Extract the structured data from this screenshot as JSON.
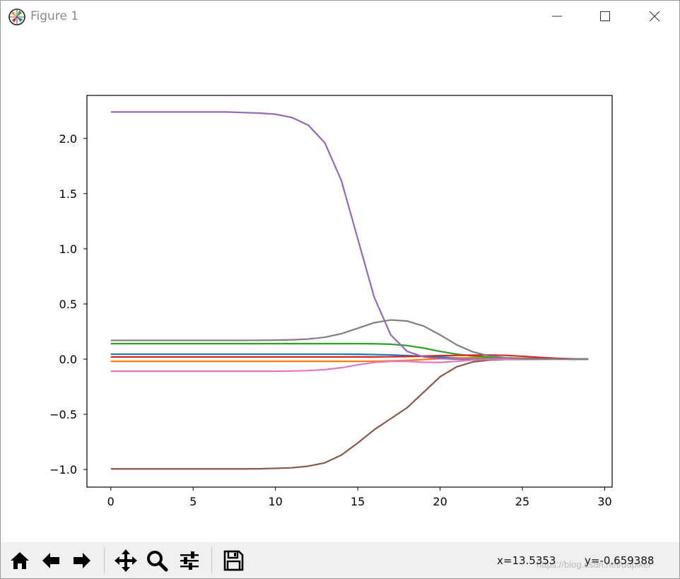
{
  "window": {
    "title": "Figure 1",
    "icon": "matplotlib-logo-icon",
    "controls": [
      "minimize-icon",
      "maximize-icon",
      "close-icon"
    ]
  },
  "toolbar": {
    "buttons": [
      {
        "name": "home-button",
        "icon": "home-icon"
      },
      {
        "name": "back-button",
        "icon": "arrow-left-icon"
      },
      {
        "name": "forward-button",
        "icon": "arrow-right-icon"
      },
      {
        "name": "pan-button",
        "icon": "move-icon"
      },
      {
        "name": "zoom-button",
        "icon": "magnifier-icon"
      },
      {
        "name": "configure-subplots-button",
        "icon": "sliders-icon"
      },
      {
        "name": "save-button",
        "icon": "floppy-disk-icon"
      }
    ],
    "cursor_x": "x=13.5353",
    "cursor_y": "y=-0.659388",
    "watermark": "https://blog.csdn.net/dupiker"
  },
  "chart_data": {
    "type": "line",
    "title": "",
    "xlabel": "",
    "ylabel": "",
    "xlim": [
      -1.45,
      30.45
    ],
    "ylim": [
      -1.16,
      2.39
    ],
    "grid": false,
    "xticks": [
      0,
      5,
      10,
      15,
      20,
      25,
      30
    ],
    "yticks": [
      2.0,
      1.5,
      1.0,
      0.5,
      0.0,
      -0.5,
      -1.0
    ],
    "ytick_labels": [
      "2.0",
      "1.5",
      "1.0",
      "0.5",
      "0.0",
      "−0.5",
      "−1.0"
    ],
    "x": [
      0,
      1,
      2,
      3,
      4,
      5,
      6,
      7,
      8,
      9,
      10,
      11,
      12,
      13,
      14,
      15,
      16,
      17,
      18,
      19,
      20,
      21,
      22,
      23,
      24,
      25,
      26,
      27,
      28,
      29
    ],
    "series": [
      {
        "color": "#1f77b4",
        "values": [
          0.045,
          0.045,
          0.045,
          0.045,
          0.045,
          0.045,
          0.045,
          0.045,
          0.045,
          0.045,
          0.045,
          0.045,
          0.045,
          0.045,
          0.045,
          0.044,
          0.042,
          0.038,
          0.032,
          0.025,
          0.018,
          0.012,
          0.008,
          0.005,
          0.003,
          0.002,
          0.001,
          0.001,
          0.0,
          0.0
        ]
      },
      {
        "color": "#ff7f0e",
        "values": [
          -0.02,
          -0.02,
          -0.02,
          -0.02,
          -0.02,
          -0.02,
          -0.02,
          -0.02,
          -0.02,
          -0.02,
          -0.02,
          -0.02,
          -0.02,
          -0.02,
          -0.02,
          -0.02,
          -0.019,
          -0.016,
          -0.011,
          -0.004,
          0.004,
          0.01,
          0.013,
          0.014,
          0.012,
          0.009,
          0.006,
          0.003,
          0.001,
          0.0
        ]
      },
      {
        "color": "#2ca02c",
        "values": [
          0.14,
          0.14,
          0.14,
          0.14,
          0.14,
          0.14,
          0.14,
          0.14,
          0.14,
          0.14,
          0.14,
          0.14,
          0.14,
          0.14,
          0.14,
          0.14,
          0.139,
          0.135,
          0.123,
          0.1,
          0.07,
          0.045,
          0.028,
          0.017,
          0.01,
          0.006,
          0.003,
          0.002,
          0.001,
          0.0
        ]
      },
      {
        "color": "#d62728",
        "values": [
          0.02,
          0.02,
          0.02,
          0.02,
          0.02,
          0.02,
          0.02,
          0.02,
          0.02,
          0.02,
          0.02,
          0.02,
          0.02,
          0.02,
          0.02,
          0.02,
          0.02,
          0.021,
          0.023,
          0.027,
          0.031,
          0.034,
          0.036,
          0.037,
          0.034,
          0.026,
          0.016,
          0.008,
          0.003,
          0.0
        ]
      },
      {
        "color": "#9467bd",
        "values": [
          2.24,
          2.24,
          2.24,
          2.24,
          2.24,
          2.24,
          2.24,
          2.24,
          2.235,
          2.23,
          2.22,
          2.19,
          2.12,
          1.96,
          1.62,
          1.09,
          0.56,
          0.22,
          0.07,
          0.02,
          0.005,
          0.0,
          -0.005,
          -0.005,
          -0.003,
          -0.002,
          -0.001,
          0.0,
          0.0,
          0.0
        ]
      },
      {
        "color": "#8c564b",
        "values": [
          -0.995,
          -0.995,
          -0.995,
          -0.995,
          -0.995,
          -0.995,
          -0.995,
          -0.995,
          -0.995,
          -0.994,
          -0.99,
          -0.985,
          -0.97,
          -0.94,
          -0.87,
          -0.76,
          -0.64,
          -0.54,
          -0.44,
          -0.3,
          -0.16,
          -0.07,
          -0.025,
          -0.008,
          -0.003,
          -0.001,
          0.0,
          0.0,
          0.0,
          0.0
        ]
      },
      {
        "color": "#e377c2",
        "values": [
          -0.11,
          -0.11,
          -0.11,
          -0.11,
          -0.11,
          -0.11,
          -0.11,
          -0.11,
          -0.11,
          -0.11,
          -0.11,
          -0.108,
          -0.104,
          -0.095,
          -0.078,
          -0.052,
          -0.03,
          -0.02,
          -0.02,
          -0.028,
          -0.03,
          -0.02,
          -0.008,
          -0.002,
          0.0,
          0.001,
          0.001,
          0.0,
          0.0,
          0.0
        ]
      },
      {
        "color": "#7f7f7f",
        "values": [
          0.17,
          0.17,
          0.17,
          0.17,
          0.17,
          0.17,
          0.17,
          0.17,
          0.17,
          0.171,
          0.172,
          0.175,
          0.182,
          0.198,
          0.23,
          0.28,
          0.33,
          0.355,
          0.345,
          0.3,
          0.22,
          0.13,
          0.065,
          0.028,
          0.012,
          0.005,
          0.002,
          0.001,
          0.0,
          0.0
        ]
      }
    ]
  }
}
